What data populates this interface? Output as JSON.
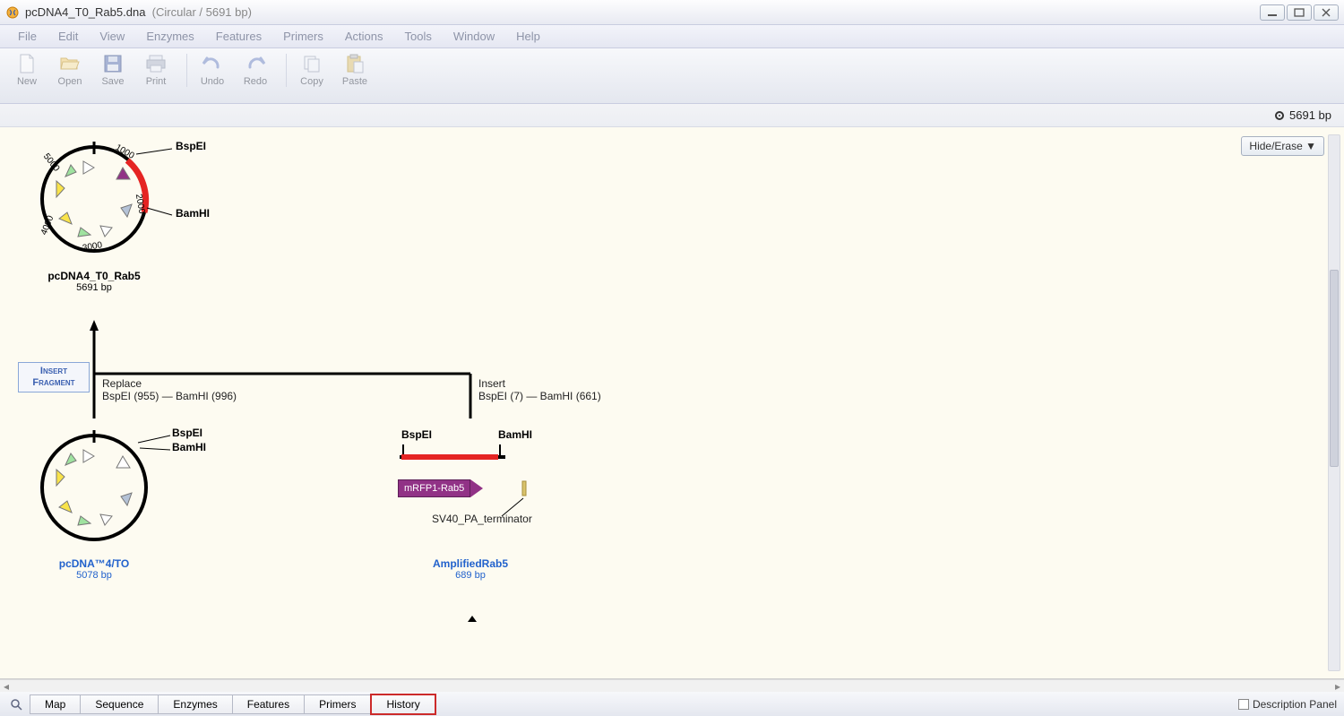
{
  "title": {
    "filename": "pcDNA4_T0_Rab5.dna",
    "meta": "(Circular / 5691 bp)"
  },
  "menu": [
    "File",
    "Edit",
    "View",
    "Enzymes",
    "Features",
    "Primers",
    "Actions",
    "Tools",
    "Window",
    "Help"
  ],
  "toolbar": {
    "new": "New",
    "open": "Open",
    "save": "Save",
    "print": "Print",
    "undo": "Undo",
    "redo": "Redo",
    "copy": "Copy",
    "paste": "Paste"
  },
  "bp_label": "5691 bp",
  "hide_erase": "Hide/Erase",
  "product": {
    "name": "pcDNA4_T0_Rab5",
    "bp": "5691 bp",
    "sites": {
      "BspEI": "BspEI",
      "BamHI": "BamHI"
    },
    "ticks": {
      "t1000": "1000",
      "t2000": "2000",
      "t3000": "3000",
      "t4000": "4000",
      "t5000": "5000"
    }
  },
  "vector": {
    "name": "pcDNA™4/TO",
    "bp": "5078 bp",
    "sites": {
      "BspEI": "BspEI",
      "BamHI": "BamHI"
    }
  },
  "fragment": {
    "name": "AmplifiedRab5",
    "bp": "689 bp",
    "mrfp": "mRFP1-Rab5",
    "sv40": "SV40_PA_terminator",
    "sites": {
      "BspEI": "BspEI",
      "BamHI": "BamHI"
    }
  },
  "operation": {
    "box_l1": "Insert",
    "box_l2": "Fragment",
    "replace_l1": "Replace",
    "replace_l2": "BspEI (955)  —  BamHI (996)",
    "insert_l1": "Insert",
    "insert_l2": "BspEI (7)  —  BamHI (661)"
  },
  "footer": {
    "tabs": [
      "Map",
      "Sequence",
      "Enzymes",
      "Features",
      "Primers",
      "History"
    ],
    "active": 5,
    "description_panel": "Description Panel"
  }
}
